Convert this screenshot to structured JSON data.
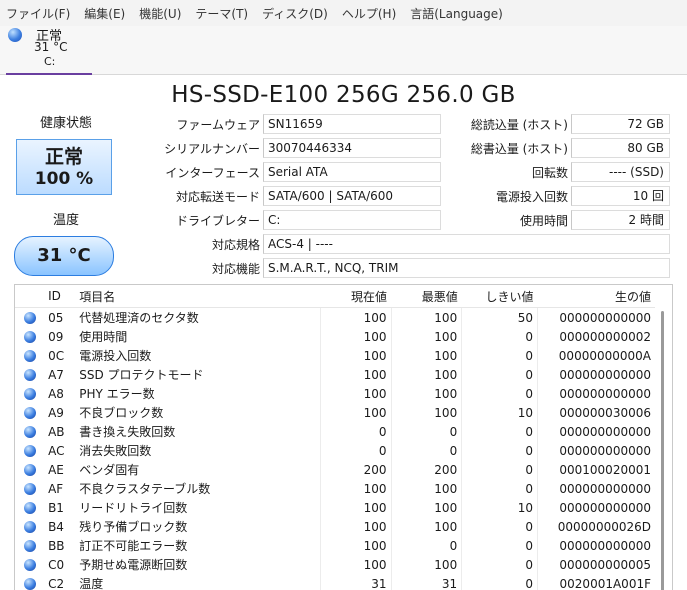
{
  "menu": [
    "ファイル(F)",
    "編集(E)",
    "機能(U)",
    "テーマ(T)",
    "ディスク(D)",
    "ヘルプ(H)",
    "言語(Language)"
  ],
  "drive_tab": {
    "status": "正常",
    "temp": "31 °C",
    "letter": "C:"
  },
  "title": "HS-SSD-E100 256G 256.0 GB",
  "health": {
    "label": "健康状態",
    "status": "正常",
    "percent": "100 %"
  },
  "temperature": {
    "label": "温度",
    "value": "31 °C"
  },
  "info": {
    "firmware_label": "ファームウェア",
    "firmware": "SN11659",
    "serial_label": "シリアルナンバー",
    "serial": "30070446334",
    "interface_label": "インターフェース",
    "interface": "Serial ATA",
    "transfer_label": "対応転送モード",
    "transfer": "SATA/600 | SATA/600",
    "drive_letter_label": "ドライブレター",
    "drive_letter": "C:",
    "standard_label": "対応規格",
    "standard": "ACS-4 | ----",
    "features_label": "対応機能",
    "features": "S.M.A.R.T., NCQ, TRIM",
    "host_reads_label": "総読込量 (ホスト)",
    "host_reads": "72 GB",
    "host_writes_label": "総書込量 (ホスト)",
    "host_writes": "80 GB",
    "rotation_label": "回転数",
    "rotation": "---- (SSD)",
    "power_count_label": "電源投入回数",
    "power_count": "10 回",
    "power_hours_label": "使用時間",
    "power_hours": "2 時間"
  },
  "table": {
    "headers": [
      "ID",
      "項目名",
      "現在値",
      "最悪値",
      "しきい値",
      "生の値"
    ],
    "rows": [
      [
        "05",
        "代替処理済のセクタ数",
        "100",
        "100",
        "50",
        "000000000000"
      ],
      [
        "09",
        "使用時間",
        "100",
        "100",
        "0",
        "000000000002"
      ],
      [
        "0C",
        "電源投入回数",
        "100",
        "100",
        "0",
        "00000000000A"
      ],
      [
        "A7",
        "SSD プロテクトモード",
        "100",
        "100",
        "0",
        "000000000000"
      ],
      [
        "A8",
        "PHY エラー数",
        "100",
        "100",
        "0",
        "000000000000"
      ],
      [
        "A9",
        "不良ブロック数",
        "100",
        "100",
        "10",
        "000000030006"
      ],
      [
        "AB",
        "書き換え失敗回数",
        "0",
        "0",
        "0",
        "000000000000"
      ],
      [
        "AC",
        "消去失敗回数",
        "0",
        "0",
        "0",
        "000000000000"
      ],
      [
        "AE",
        "ベンダ固有",
        "200",
        "200",
        "0",
        "000100020001"
      ],
      [
        "AF",
        "不良クラスタテーブル数",
        "100",
        "100",
        "0",
        "000000000000"
      ],
      [
        "B1",
        "リードリトライ回数",
        "100",
        "100",
        "10",
        "000000000000"
      ],
      [
        "B4",
        "残り予備ブロック数",
        "100",
        "100",
        "0",
        "00000000026D"
      ],
      [
        "BB",
        "訂正不可能エラー数",
        "100",
        "0",
        "0",
        "000000000000"
      ],
      [
        "C0",
        "予期せぬ電源断回数",
        "100",
        "100",
        "0",
        "000000000005"
      ],
      [
        "C2",
        "温度",
        "31",
        "31",
        "0",
        "0020001A001F"
      ]
    ]
  }
}
